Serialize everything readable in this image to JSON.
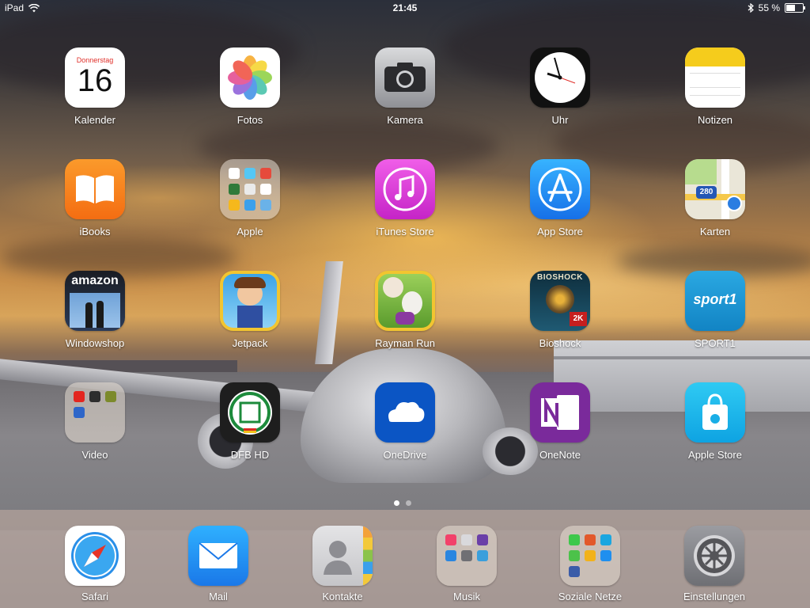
{
  "status_bar": {
    "device": "iPad",
    "time": "21:45",
    "battery_percent": "55 %",
    "battery_level": 0.55,
    "icons": [
      "wifi-icon",
      "bluetooth-icon",
      "battery-icon"
    ]
  },
  "calendar": {
    "weekday": "Donnerstag",
    "day": "16"
  },
  "maps": {
    "shield": "280"
  },
  "third_party_badges": {
    "amazon": "amazon",
    "sport1": "sport1",
    "bioshock": "BIOSHOCK",
    "bioshock_publisher": "2K"
  },
  "apps": [
    {
      "label": "Kalender",
      "icon": "calendar-icon"
    },
    {
      "label": "Fotos",
      "icon": "photos-icon"
    },
    {
      "label": "Kamera",
      "icon": "camera-icon"
    },
    {
      "label": "Uhr",
      "icon": "clock-icon"
    },
    {
      "label": "Notizen",
      "icon": "notes-icon"
    },
    {
      "label": "iBooks",
      "icon": "ibooks-icon"
    },
    {
      "label": "Apple",
      "icon": "folder-icon"
    },
    {
      "label": "iTunes Store",
      "icon": "itunes-store-icon"
    },
    {
      "label": "App Store",
      "icon": "app-store-icon"
    },
    {
      "label": "Karten",
      "icon": "maps-icon"
    },
    {
      "label": "Windowshop",
      "icon": "amazon-windowshop-icon"
    },
    {
      "label": "Jetpack",
      "icon": "jetpack-icon"
    },
    {
      "label": "Rayman Run",
      "icon": "rayman-run-icon"
    },
    {
      "label": "Bioshock",
      "icon": "bioshock-icon"
    },
    {
      "label": "SPORT1",
      "icon": "sport1-icon"
    },
    {
      "label": "Video",
      "icon": "folder-icon"
    },
    {
      "label": "DFB HD",
      "icon": "dfb-icon"
    },
    {
      "label": "OneDrive",
      "icon": "onedrive-icon"
    },
    {
      "label": "OneNote",
      "icon": "onenote-icon"
    },
    {
      "label": "Apple Store",
      "icon": "apple-store-icon"
    }
  ],
  "dock": [
    {
      "label": "Safari",
      "icon": "safari-icon"
    },
    {
      "label": "Mail",
      "icon": "mail-icon"
    },
    {
      "label": "Kontakte",
      "icon": "contacts-icon"
    },
    {
      "label": "Musik",
      "icon": "folder-icon"
    },
    {
      "label": "Soziale Netze",
      "icon": "folder-icon"
    },
    {
      "label": "Einstellungen",
      "icon": "settings-icon"
    }
  ],
  "page_indicator": {
    "pages": 2,
    "current": 1
  },
  "colors": {
    "itunes": "#e03bd8",
    "appstore": "#1e8cf0",
    "ibooks": "#f7821b",
    "onedrive": "#0b55c4",
    "onenote": "#7a2a9b",
    "sport1": "#1b9ad6",
    "applestore": "#16b6ea",
    "mail": "#1f8ef1",
    "notes_header": "#f5cc1c",
    "calendar_red": "#e0302a"
  }
}
